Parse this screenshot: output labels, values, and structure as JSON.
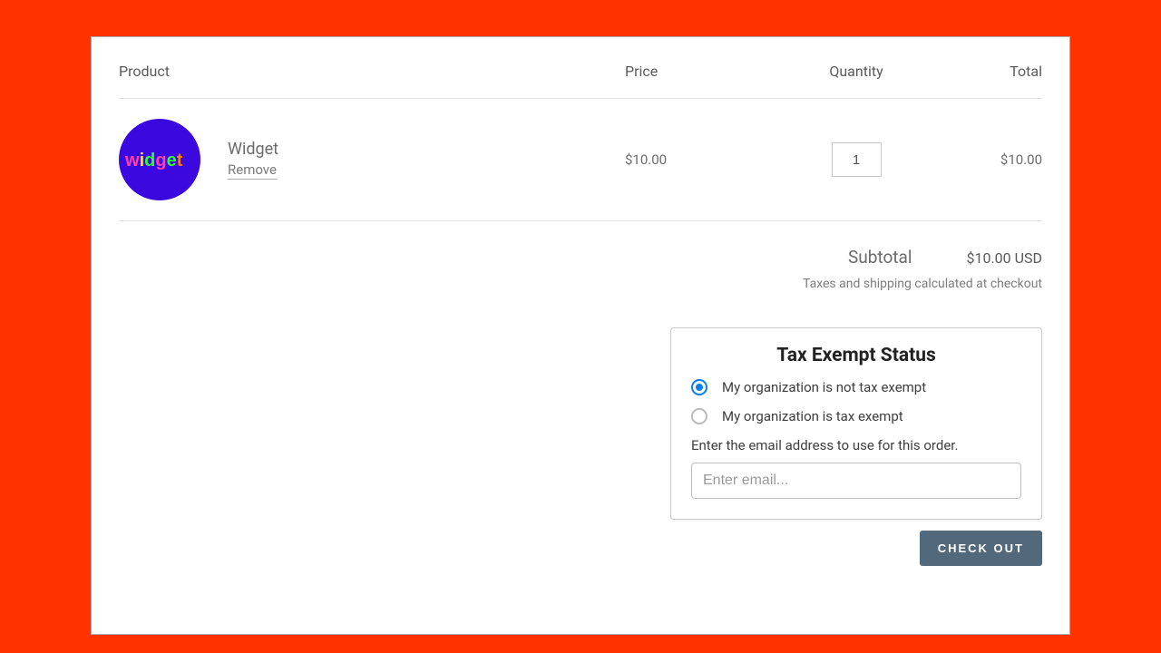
{
  "headers": {
    "product": "Product",
    "price": "Price",
    "quantity": "Quantity",
    "total": "Total"
  },
  "item": {
    "name": "Widget",
    "removeLabel": "Remove",
    "price": "$10.00",
    "quantity": "1",
    "lineTotal": "$10.00"
  },
  "summary": {
    "subtotalLabel": "Subtotal",
    "subtotalValue": "$10.00 USD",
    "note": "Taxes and shipping calculated at checkout"
  },
  "taxExempt": {
    "title": "Tax Exempt Status",
    "optionNotExempt": "My organization is not tax exempt",
    "optionExempt": "My organization is tax exempt",
    "emailLabel": "Enter the email address to use for this order.",
    "emailPlaceholder": "Enter email..."
  },
  "checkoutLabel": "CHECK OUT"
}
